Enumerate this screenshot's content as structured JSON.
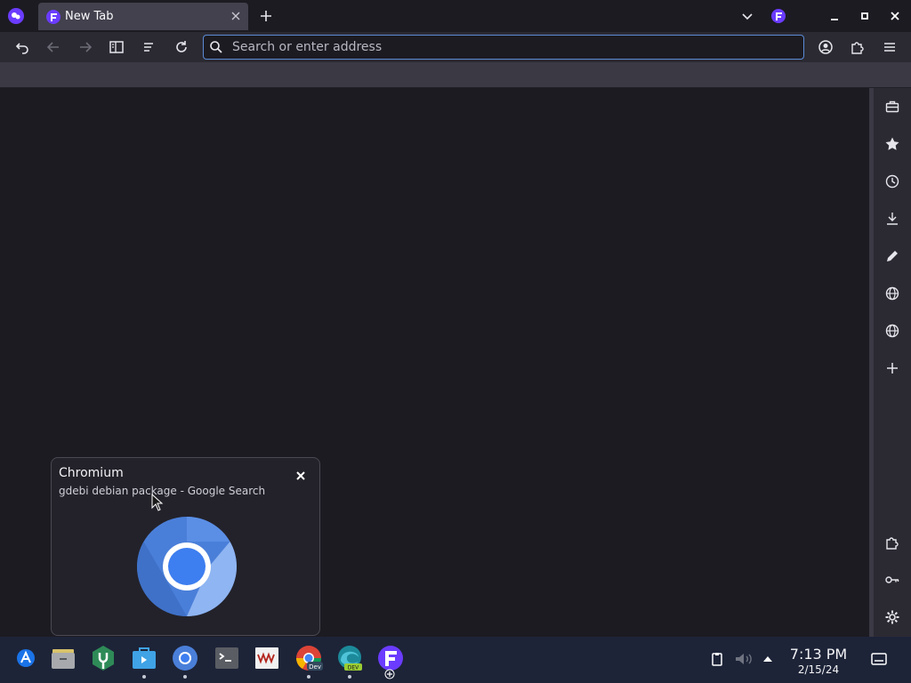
{
  "tab": {
    "title": "New Tab"
  },
  "toolbar": {
    "search_placeholder": "Search or enter address"
  },
  "popup": {
    "title": "Chromium",
    "subtitle": "gdebi debian package - Google Search"
  },
  "taskbar": {
    "time": "7:13 PM",
    "date": "2/15/24"
  },
  "icons": {
    "sidebar": [
      "briefcase-icon",
      "star-icon",
      "history-icon",
      "download-icon",
      "pen-icon",
      "globe-icon",
      "globe-icon",
      "plus-icon",
      "puzzle-icon",
      "key-icon",
      "gear-icon"
    ],
    "taskbar": [
      "launcher-icon",
      "files-icon",
      "software-manager-icon",
      "store-icon",
      "chromium-icon",
      "terminal-icon",
      "vm-app-icon",
      "chrome-dev-icon",
      "edge-dev-icon",
      "floorp-icon"
    ]
  },
  "colors": {
    "accent": "#5b8bd6",
    "brand": "#6b3cff",
    "chromium_blue": "#4a7fd9"
  }
}
